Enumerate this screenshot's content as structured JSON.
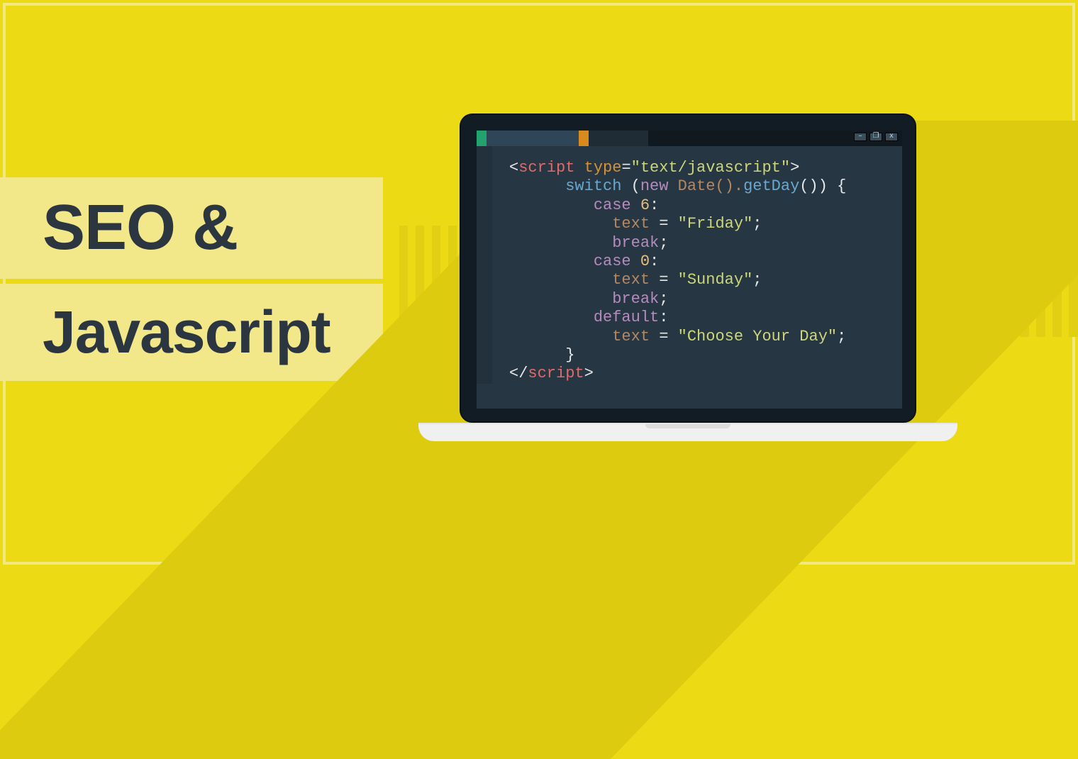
{
  "headings": {
    "line1": "SEO &",
    "line2": "Javascript"
  },
  "editor": {
    "window_buttons": [
      "–",
      "❐",
      "x"
    ],
    "tokens": {
      "lt": "<",
      "gt": ">",
      "slash": "/",
      "script": "script",
      "type_attr": " type",
      "eq": "=",
      "type_val": "\"text/javascript\"",
      "switch": "switch",
      "paren_open": " (",
      "new": "new",
      "date_call": " Date().",
      "getday": "getDay",
      "paren_tail": "()) {",
      "case": "case",
      "six": " 6",
      "zero": " 0",
      "colon": ":",
      "text": "text",
      "eq_sp": " = ",
      "friday": "\"Friday\"",
      "sunday": "\"Sunday\"",
      "choose": "\"Choose Your Day\"",
      "semi": ";",
      "break": "break",
      "default": "default",
      "brace_close": "}"
    }
  }
}
